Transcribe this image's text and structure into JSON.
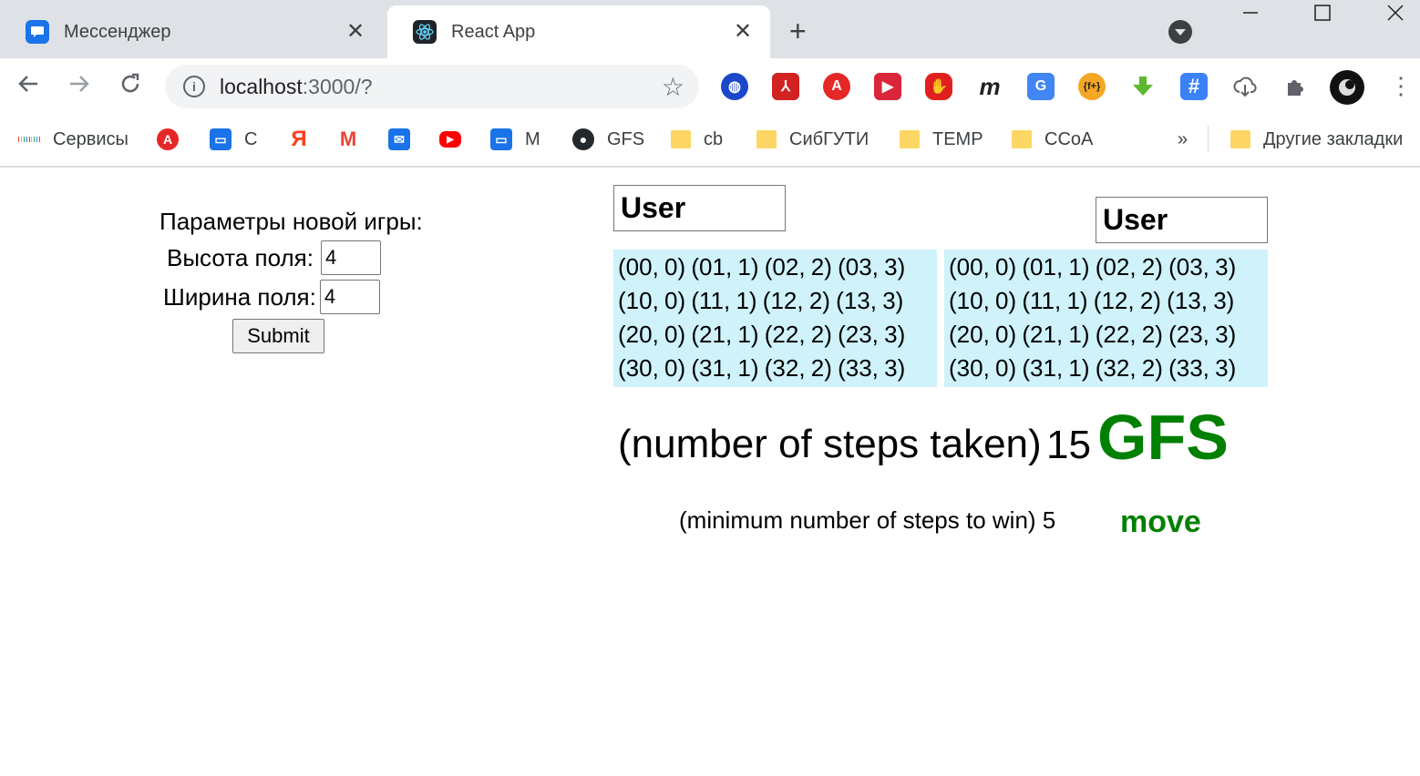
{
  "browser": {
    "tabs": [
      {
        "title": "Мессенджер",
        "icon": "messenger-icon",
        "active": false
      },
      {
        "title": "React App",
        "icon": "react-icon",
        "active": true
      }
    ],
    "address": {
      "host": "localhost",
      "rest": ":3000/?"
    },
    "bookmarks": [
      {
        "label": "Сервисы",
        "icon": "apps-grid-icon"
      },
      {
        "label": "",
        "icon": "translate-icon"
      },
      {
        "label": "С",
        "icon": "messenger-icon"
      },
      {
        "label": "",
        "icon": "yandex-icon"
      },
      {
        "label": "",
        "icon": "gmail-icon"
      },
      {
        "label": "",
        "icon": "mail-icon"
      },
      {
        "label": "",
        "icon": "youtube-icon"
      },
      {
        "label": "М",
        "icon": "messenger-icon"
      },
      {
        "label": "GFS",
        "icon": "github-icon"
      },
      {
        "label": "cb",
        "icon": "folder-icon"
      },
      {
        "label": "СибГУТИ",
        "icon": "folder-icon"
      },
      {
        "label": "TEMP",
        "icon": "folder-icon"
      },
      {
        "label": "CCoA",
        "icon": "folder-icon"
      }
    ],
    "overflow_label": "»",
    "other_bookmarks": "Другие закладки",
    "colors": {
      "tabstrip": "#dee1e6",
      "folder": "#fdd663",
      "accent": "#1a73e8"
    }
  },
  "form": {
    "title": "Параметры новой игры:",
    "height_label": "Высота поля:",
    "height_value": "4",
    "width_label": "Ширина поля:",
    "width_value": "4",
    "submit_label": "Submit"
  },
  "players": [
    {
      "name": "User"
    },
    {
      "name": "User"
    }
  ],
  "boards": [
    {
      "rows": [
        "(00, 0) (01, 1) (02, 2) (03, 3)",
        "(10, 0) (11, 1) (12, 2) (13, 3)",
        "(20, 0) (21, 1) (22, 2) (23, 3)",
        "(30, 0) (31, 1) (32, 2) (33, 3)"
      ]
    },
    {
      "rows": [
        "(00, 0) (01, 1) (02, 2) (03, 3)",
        "(10, 0) (11, 1) (12, 2) (13, 3)",
        "(20, 0) (21, 1) (22, 2) (23, 3)",
        "(30, 0) (31, 1) (32, 2) (33, 3)"
      ]
    }
  ],
  "status": {
    "steps_label": "(number of steps taken)",
    "steps_value": "15",
    "algo": "GFS",
    "min_label": "(minimum number of steps to win) 5",
    "move_label": "move",
    "highlight_color": "#008000",
    "board_color": "#cff2fb"
  }
}
